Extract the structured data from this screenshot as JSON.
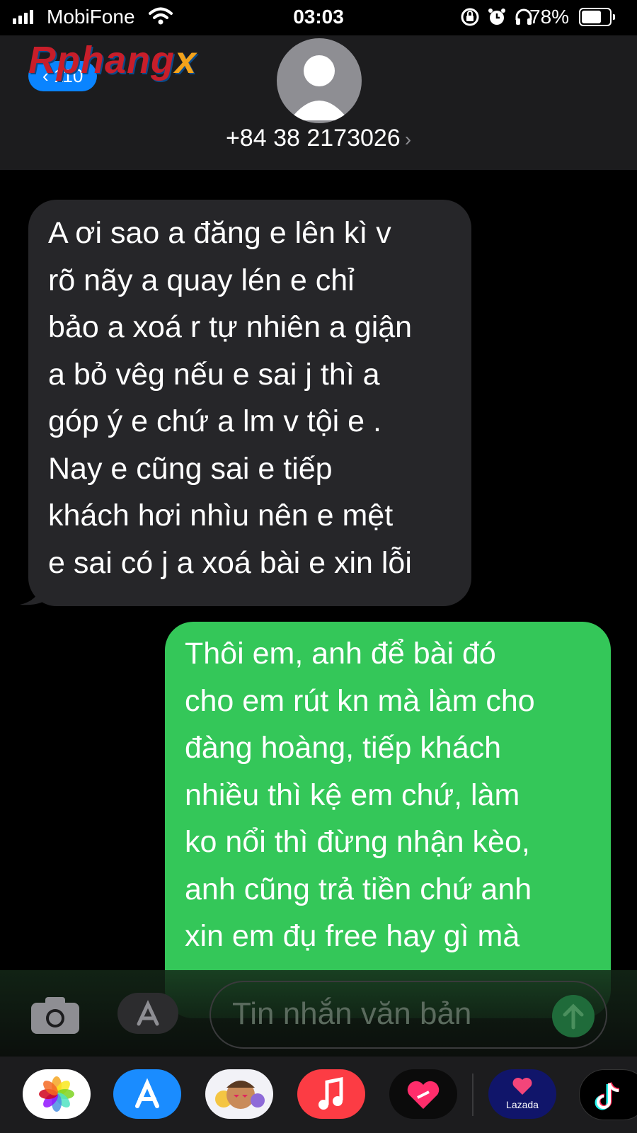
{
  "status_bar": {
    "carrier": "MobiFone",
    "time": "03:03",
    "battery_percent": "78%",
    "battery_level": 0.78
  },
  "header": {
    "watermark": "Rphang",
    "watermark_x": "x",
    "back_count": "110",
    "contact": "+84 38 2173026",
    "chevron": "›"
  },
  "messages": [
    {
      "from": "them",
      "text": "A ơi sao a đăng e lên kì v\nrõ nãy a quay lén e chỉ\nbảo a xoá r tự nhiên a giận\na bỏ vêg nếu e sai j thì a\ngóp ý e chứ a lm v tội e .\nNay e cũng sai e tiếp\nkhách hơi nhìu nên e  mệt\ne sai có j a xoá bài e xin lỗi"
    },
    {
      "from": "me",
      "text": "Thôi em, anh để bài đó\ncho em rút kn mà làm cho\nđàng hoàng, tiếp khách\nnhiều thì kệ em chứ, làm\nko nổi thì đừng nhận kèo,\nanh cũng trả tiền chứ anh\nxin em đụ free hay gì mà"
    }
  ],
  "input": {
    "placeholder": "Tin nhắn văn bản"
  },
  "app_strip": {
    "apps": [
      "photos-icon",
      "app-store-icon",
      "memoji-icon",
      "music-icon",
      "heart-app-icon",
      "lazada-icon",
      "tiktok-icon"
    ],
    "lazada_label": "Lazada"
  },
  "colors": {
    "incoming_bubble": "#262629",
    "outgoing_bubble": "#34c759",
    "accent": "#0a84ff"
  }
}
